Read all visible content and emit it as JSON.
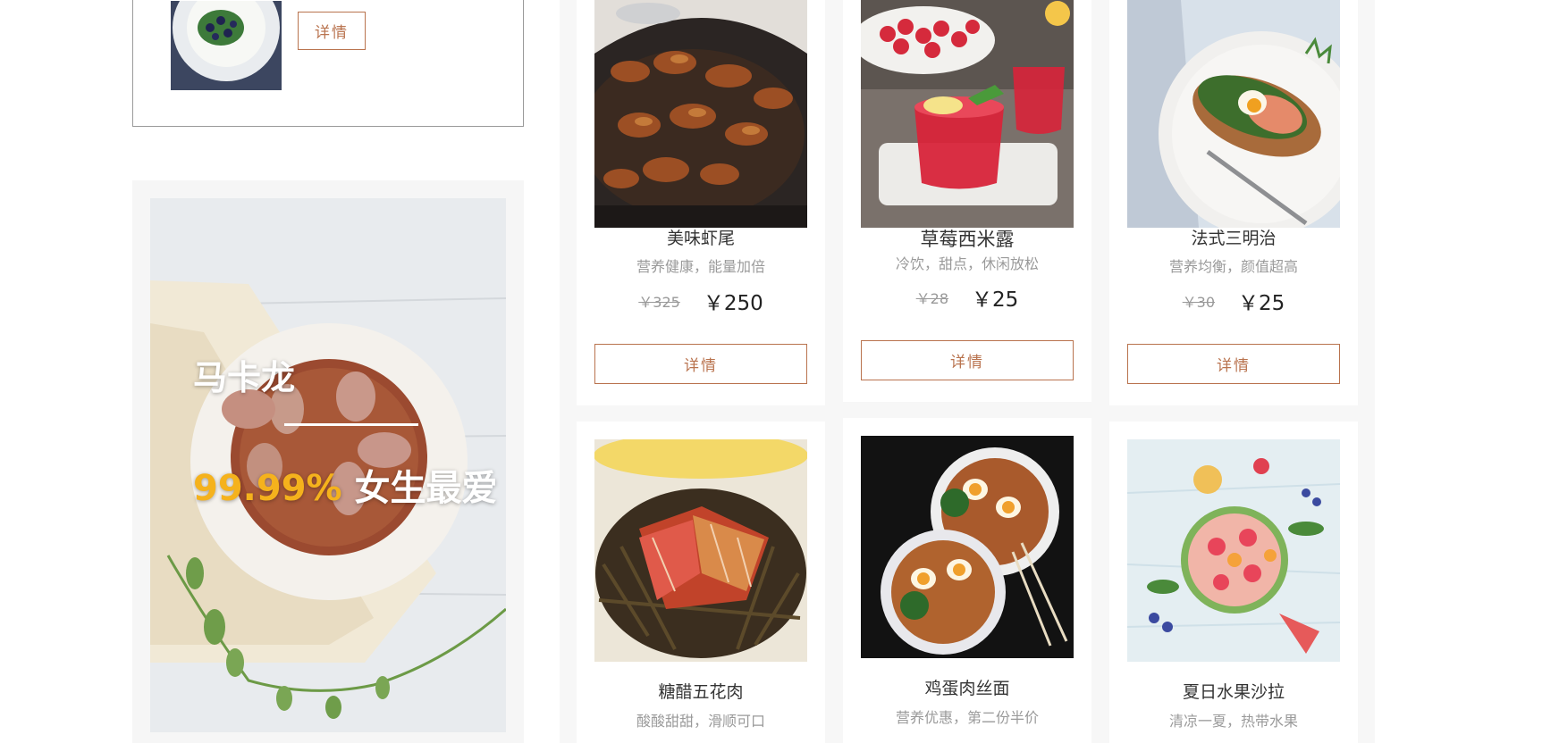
{
  "top_box": {
    "detail_label": "详情"
  },
  "promo": {
    "title": "马卡龙",
    "percent": "99.99%",
    "subtitle_rest": "女生最爱"
  },
  "products": [
    {
      "name": "美味虾尾",
      "desc": "营养健康，能量加倍",
      "old_price": "￥325",
      "new_price": "￥250",
      "detail_label": "详情"
    },
    {
      "name": "草莓西米露",
      "desc": "冷饮，甜点，休闲放松",
      "old_price": "￥28",
      "new_price": "￥25",
      "detail_label": "详情"
    },
    {
      "name": "法式三明治",
      "desc": "营养均衡，颜值超高",
      "old_price": "￥30",
      "new_price": "￥25",
      "detail_label": "详情"
    },
    {
      "name": "糖醋五花肉",
      "desc": "酸酸甜甜，滑顺可口"
    },
    {
      "name": "鸡蛋肉丝面",
      "desc": "营养优惠，第二份半价"
    },
    {
      "name": "夏日水果沙拉",
      "desc": "清凉一夏，热带水果"
    }
  ],
  "colors": {
    "accent": "#b9734e",
    "highlight": "#f5b21c",
    "muted_text": "#9a9a9a",
    "panel_bg": "#f7f7f7"
  }
}
